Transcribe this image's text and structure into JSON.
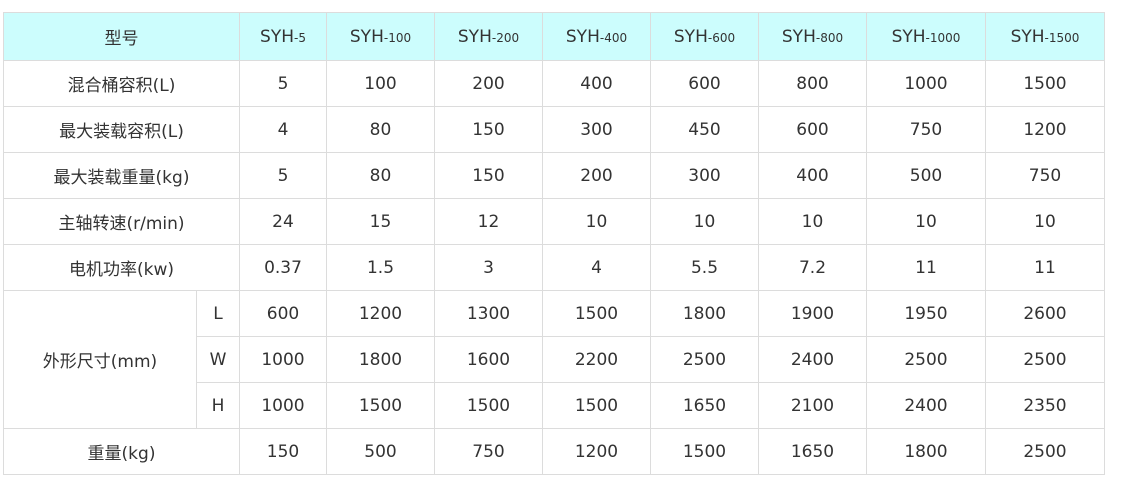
{
  "table": {
    "header": {
      "label": "型号",
      "models": [
        {
          "base": "SYH",
          "sub": "-5"
        },
        {
          "base": "SYH",
          "sub": "-100"
        },
        {
          "base": "SYH",
          "sub": "-200"
        },
        {
          "base": "SYH",
          "sub": "-400"
        },
        {
          "base": "SYH",
          "sub": "-600"
        },
        {
          "base": "SYH",
          "sub": "-800"
        },
        {
          "base": "SYH",
          "sub": "-1000"
        },
        {
          "base": "SYH",
          "sub": "-1500"
        }
      ]
    },
    "rows": [
      {
        "label": "混合桶容积(L)",
        "values": [
          "5",
          "100",
          "200",
          "400",
          "600",
          "800",
          "1000",
          "1500"
        ]
      },
      {
        "label": "最大装载容积(L)",
        "values": [
          "4",
          "80",
          "150",
          "300",
          "450",
          "600",
          "750",
          "1200"
        ]
      },
      {
        "label": "最大装载重量(kg)",
        "values": [
          "5",
          "80",
          "150",
          "200",
          "300",
          "400",
          "500",
          "750"
        ]
      },
      {
        "label": "主轴转速(r/min)",
        "values": [
          "24",
          "15",
          "12",
          "10",
          "10",
          "10",
          "10",
          "10"
        ]
      },
      {
        "label": "电机功率(kw)",
        "values": [
          "0.37",
          "1.5",
          "3",
          "4",
          "5.5",
          "7.2",
          "11",
          "11"
        ]
      }
    ],
    "dimensions": {
      "label": "外形尺寸(mm)",
      "rows": [
        {
          "axis": "L",
          "values": [
            "600",
            "1200",
            "1300",
            "1500",
            "1800",
            "1900",
            "1950",
            "2600"
          ]
        },
        {
          "axis": "W",
          "values": [
            "1000",
            "1800",
            "1600",
            "2200",
            "2500",
            "2400",
            "2500",
            "2500"
          ]
        },
        {
          "axis": "H",
          "values": [
            "1000",
            "1500",
            "1500",
            "1500",
            "1650",
            "2100",
            "2400",
            "2350"
          ]
        }
      ]
    },
    "weight": {
      "label": "重量(kg)",
      "values": [
        "150",
        "500",
        "750",
        "1200",
        "1500",
        "1650",
        "1800",
        "2500"
      ]
    }
  }
}
